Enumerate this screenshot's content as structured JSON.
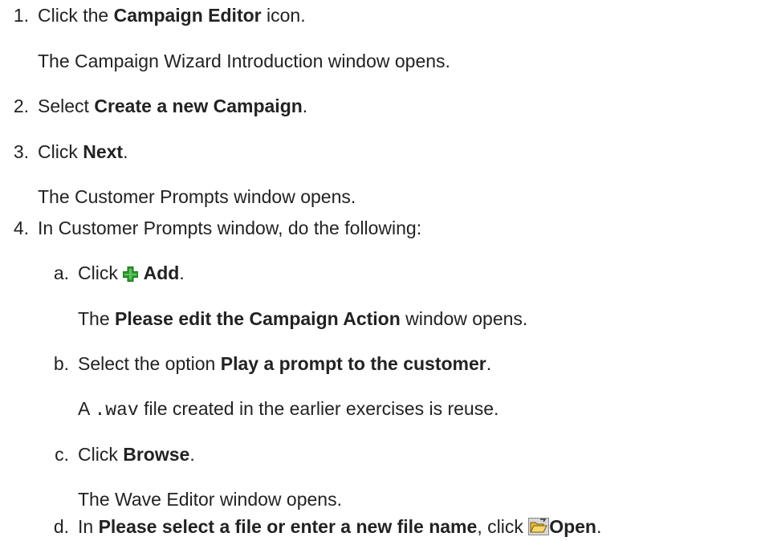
{
  "steps": {
    "s1": {
      "num": "1.",
      "pre": "Click the ",
      "bold": "Campaign Editor",
      "post": " icon.",
      "result": "The Campaign Wizard Introduction window opens."
    },
    "s2": {
      "num": "2.",
      "pre": "Select ",
      "bold": "Create a new Campaign",
      "post": "."
    },
    "s3": {
      "num": "3.",
      "pre": "Click ",
      "bold": "Next",
      "post": ".",
      "result": "The Customer Prompts window opens."
    },
    "s4": {
      "num": "4.",
      "text": "In Customer Prompts window, do the following:"
    },
    "a": {
      "num": "a.",
      "pre": "Click ",
      "icon": "green-plus-icon",
      "bold": "Add",
      "post": ".",
      "result_pre": "The ",
      "result_bold": "Please edit the Campaign Action",
      "result_post": " window opens."
    },
    "b": {
      "num": "b.",
      "pre": "Select the option ",
      "bold": "Play a prompt to the customer",
      "post": ".",
      "result_pre": "A ",
      "result_code": ".wav",
      "result_post": " file created in the earlier exercises is reuse."
    },
    "c": {
      "num": "c.",
      "pre": "Click ",
      "bold": "Browse",
      "post": ".",
      "result": "The Wave Editor window opens."
    },
    "d": {
      "num": "d.",
      "pre": "In ",
      "bold": "Please select a file or enter a new file name",
      "mid": ", click ",
      "icon": "open-folder-icon",
      "bold2": "Open",
      "post": "."
    }
  }
}
